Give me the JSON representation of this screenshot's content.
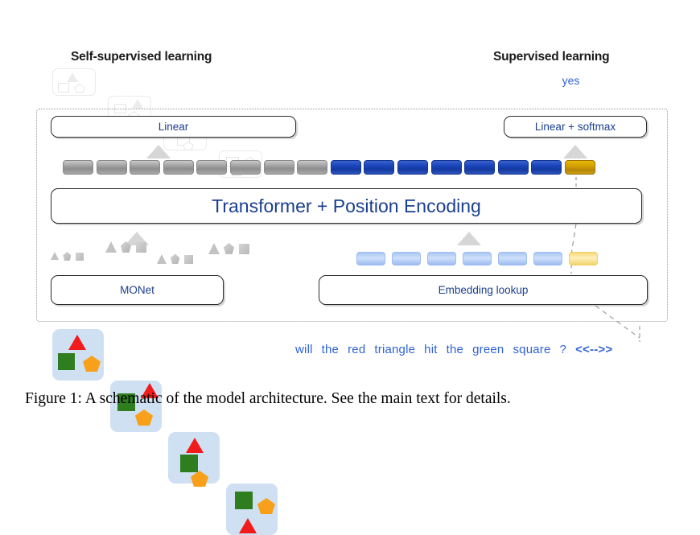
{
  "figure": {
    "caption": "Figure 1:  A schematic of the model architecture. See the main text for details."
  },
  "headings": {
    "self_supervised": "Self-supervised learning",
    "supervised": "Supervised learning",
    "supervised_answer": "yes"
  },
  "modules": {
    "linear": "Linear",
    "linear_softmax": "Linear + softmax",
    "transformer": "Transformer + Position Encoding",
    "monet": "MONet",
    "embedding_lookup": "Embedding lookup"
  },
  "token_row": {
    "gray_count": 8,
    "blue_count": 7,
    "gold_count": 1,
    "total": 16
  },
  "embedding_row": {
    "light_blue_count": 6,
    "light_gold_count": 1,
    "total": 7
  },
  "ghost_tiles": [
    {
      "id": "ghost-tile-1"
    },
    {
      "id": "ghost-tile-2"
    },
    {
      "id": "ghost-tile-3"
    },
    {
      "id": "ghost-tile-4"
    }
  ],
  "monet_shape_groups": [
    {
      "id": "shape-group-1",
      "scale": "small"
    },
    {
      "id": "shape-group-2",
      "scale": "large"
    },
    {
      "id": "shape-group-3",
      "scale": "medium"
    },
    {
      "id": "shape-group-4",
      "scale": "large"
    }
  ],
  "image_tiles": [
    {
      "id": "image-tile-1",
      "shapes": [
        "red-triangle",
        "green-square",
        "orange-pentagon"
      ]
    },
    {
      "id": "image-tile-2",
      "shapes": [
        "green-square",
        "red-triangle",
        "orange-pentagon"
      ]
    },
    {
      "id": "image-tile-3",
      "shapes": [
        "red-triangle",
        "green-square",
        "orange-pentagon"
      ]
    },
    {
      "id": "image-tile-4",
      "shapes": [
        "green-square",
        "orange-pentagon",
        "red-triangle"
      ]
    }
  ],
  "sentence": {
    "tokens": [
      "will",
      "the",
      "red",
      "triangle",
      "hit",
      "the",
      "green",
      "square",
      "?"
    ],
    "special_token": "<<-->>"
  },
  "colors": {
    "text_blue": "#2f62d6",
    "module_text": "#1b3f8f",
    "chip_blue": "#1a43bb",
    "chip_gray": "#9e9e9e",
    "chip_gold": "#c8960c",
    "tile_bg": "#cfe0f2",
    "shape_red": "#f21b1b",
    "shape_green": "#2e7d1e",
    "shape_orange": "#f9a01b",
    "arrow_gray": "#d6d6d6",
    "dotted_border": "#9a9a9a"
  }
}
